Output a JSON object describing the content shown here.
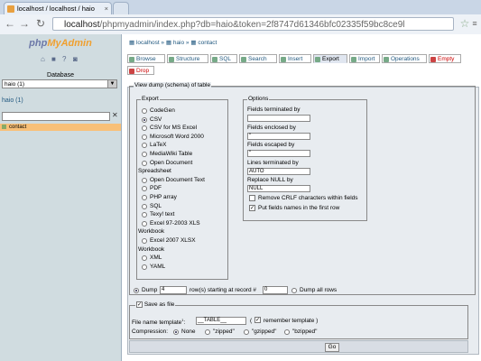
{
  "browser": {
    "tab_title": "localhost / localhost / haio",
    "url_host": "localhost",
    "url_path": "/phpmyadmin/index.php?db=haio&token=2f8747d61346bfc02335f59bc8ce9l"
  },
  "sidebar": {
    "logo_part1": "php",
    "logo_part2": "MyAdmin",
    "database_label": "Database",
    "database_value": "haio (1)",
    "db_link": "haio (1)",
    "table_item": "contact"
  },
  "breadcrumb": {
    "server": "localhost",
    "db": "haio",
    "table": "contact"
  },
  "tabs": [
    "Browse",
    "Structure",
    "SQL",
    "Search",
    "Insert",
    "Export",
    "Import",
    "Operations",
    "Empty",
    "Drop"
  ],
  "export": {
    "legend": "View dump (schema) of table",
    "export_legend": "Export",
    "formats": [
      "CodeGen",
      "CSV",
      "CSV for MS Excel",
      "Microsoft Word 2000",
      "LaTeX",
      "MediaWiki Table",
      "Open Document"
    ],
    "group_spreadsheet": "Spreadsheet",
    "formats2": [
      "Open Document Text",
      "PDF",
      "PHP array",
      "SQL",
      "Texy! text",
      "Excel 97-2003 XLS"
    ],
    "group_workbook": "Workbook",
    "formats3": [
      "Excel 2007 XLSX"
    ],
    "group_workbook2": "Workbook",
    "formats4": [
      "XML",
      "YAML"
    ],
    "options_legend": "Options",
    "opt_fields_terminated": "Fields terminated by",
    "opt_fields_enclosed": "Fields enclosed by",
    "val_fields_enclosed": "\"",
    "opt_fields_escaped": "Fields escaped by",
    "val_fields_escaped": "\"",
    "opt_lines_terminated": "Lines terminated by",
    "val_lines_terminated": "AUTO",
    "opt_replace_null": "Replace NULL by",
    "val_replace_null": "NULL",
    "opt_remove_crlf": "Remove CRLF characters within fields",
    "opt_put_names": "Put fields names in the first row",
    "dump_label": "Dump",
    "dump_rows": "4",
    "dump_starting": "row(s) starting at record #",
    "dump_start_val": "0",
    "dump_all": "Dump all rows"
  },
  "save": {
    "legend": "Save as file",
    "template_label": "File name template",
    "template_sup": "1",
    "template_colon": ":",
    "template_value": "__TABLE__",
    "remember_open": "(",
    "remember_label": "remember template )",
    "compression_label": "Compression:",
    "compression_options": [
      "None",
      "\"zipped\"",
      "\"gzipped\"",
      "\"bzipped\""
    ],
    "go": "Go"
  }
}
